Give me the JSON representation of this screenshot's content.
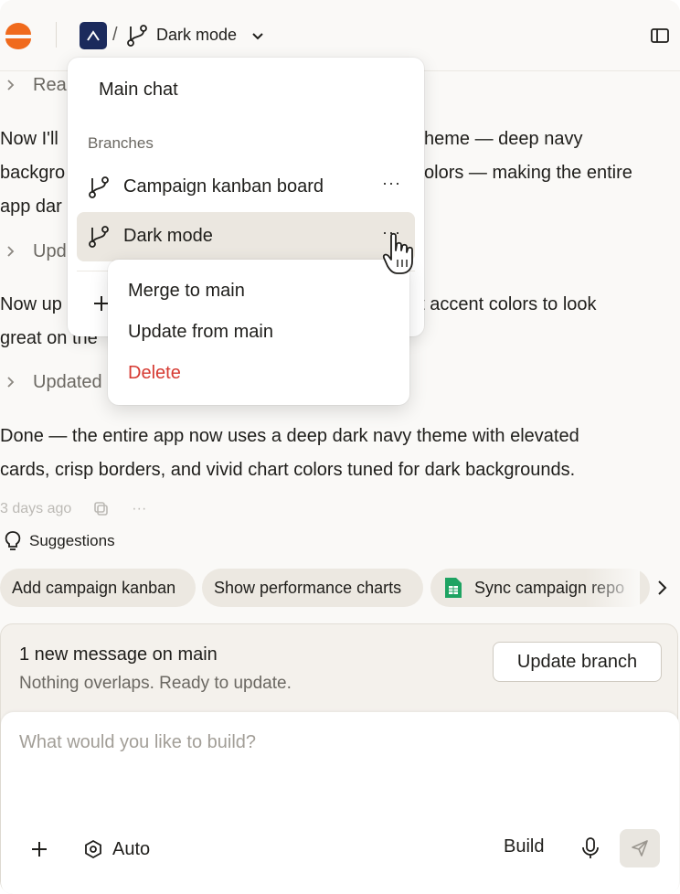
{
  "header": {
    "separator": "/",
    "branch_name": "Dark mode"
  },
  "conversation": {
    "blocks": [
      {
        "type": "collapsed",
        "label": "Rea"
      },
      {
        "type": "text",
        "lines": [
          "Now I'll",
          "backgro",
          "app dar"
        ],
        "right_lines": [
          "heme — deep navy",
          "olors — making the entire"
        ]
      },
      {
        "type": "collapsed",
        "label": "Upd"
      },
      {
        "type": "text",
        "lines": [
          "Now up",
          "great on the"
        ],
        "right_lines": [
          "nt accent colors to look"
        ]
      },
      {
        "type": "collapsed",
        "label": "Updated"
      },
      {
        "type": "text",
        "lines": [
          "Done — the entire app now uses a deep dark navy theme with elevated",
          "cards, crisp borders, and vivid chart colors tuned for dark backgrounds."
        ]
      }
    ],
    "meta_timestamp": "3 days ago"
  },
  "suggestions": {
    "heading": "Suggestions",
    "chips": [
      "Add campaign kanban",
      "Show performance charts",
      "Sync campaign repo"
    ]
  },
  "update_card": {
    "title": "1 new message on main",
    "subtitle": "Nothing overlaps. Ready to update.",
    "button_label": "Update branch"
  },
  "composer": {
    "placeholder": "What would you like to build?",
    "mode_label": "Auto",
    "build_label": "Build"
  },
  "branch_menu": {
    "main_label": "Main chat",
    "section_label": "Branches",
    "branches": [
      {
        "label": "Campaign kanban board",
        "more": "···",
        "active": false
      },
      {
        "label": "Dark mode",
        "more": "···",
        "active": true
      }
    ]
  },
  "context_menu": {
    "items": [
      {
        "label": "Merge to main",
        "danger": false
      },
      {
        "label": "Update from main",
        "danger": false
      },
      {
        "label": "Delete",
        "danger": true
      }
    ]
  },
  "colors": {
    "logo_orange": "#f06a1c",
    "project_icon_bg": "#1b2a5c",
    "danger_red": "#d63a32",
    "sheets_green": "#1ea362"
  }
}
